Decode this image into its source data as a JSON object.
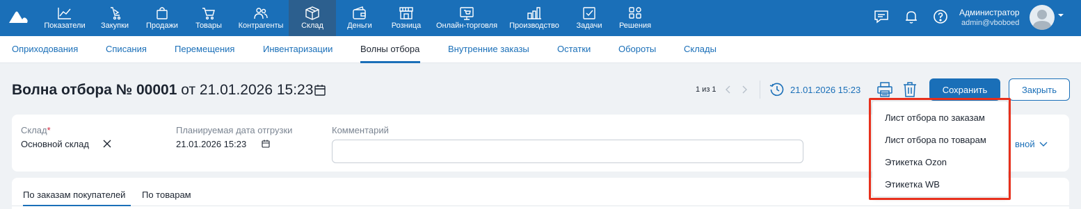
{
  "topnav": {
    "items": [
      {
        "label": "Показатели",
        "icon": "chart-line-icon"
      },
      {
        "label": "Закупки",
        "icon": "purchase-icon"
      },
      {
        "label": "Продажи",
        "icon": "shopping-bag-icon"
      },
      {
        "label": "Товары",
        "icon": "cart-icon"
      },
      {
        "label": "Контрагенты",
        "icon": "users-icon"
      },
      {
        "label": "Склад",
        "icon": "box-icon",
        "active": true
      },
      {
        "label": "Деньги",
        "icon": "wallet-icon"
      },
      {
        "label": "Розница",
        "icon": "store-icon"
      },
      {
        "label": "Онлайн-торговля",
        "icon": "online-store-icon"
      },
      {
        "label": "Производство",
        "icon": "factory-icon"
      },
      {
        "label": "Задачи",
        "icon": "task-check-icon"
      },
      {
        "label": "Решения",
        "icon": "apps-grid-icon"
      }
    ],
    "user": {
      "name": "Администратор",
      "email": "admin@vboboed"
    },
    "accent": "#1a6fb8",
    "active_bg": "#2c5f8e"
  },
  "subnav": {
    "items": [
      {
        "label": "Оприходования"
      },
      {
        "label": "Списания"
      },
      {
        "label": "Перемещения"
      },
      {
        "label": "Инвентаризации"
      },
      {
        "label": "Волны отбора",
        "active": true
      },
      {
        "label": "Внутренние заказы"
      },
      {
        "label": "Остатки"
      },
      {
        "label": "Обороты"
      },
      {
        "label": "Склады"
      }
    ]
  },
  "document": {
    "title": "Волна отбора № 00001",
    "date_prefix": "от",
    "date": "21.01.2026 15:23",
    "pager": "1 из 1",
    "history_date": "21.01.2026 15:23",
    "save_label": "Сохранить",
    "close_label": "Закрыть"
  },
  "form": {
    "warehouse_label": "Склад",
    "required_mark": "*",
    "warehouse_value": "Основной склад",
    "ship_label": "Планируемая дата отгрузки",
    "ship_value": "21.01.2026 15:23",
    "comment_label": "Комментарий",
    "comment_value": "",
    "partial_value": "вной"
  },
  "tabs": [
    {
      "label": "По заказам покупателей",
      "active": true
    },
    {
      "label": "По товарам"
    }
  ],
  "print_menu": {
    "items": [
      "Лист отбора по заказам",
      "Лист отбора по товарам",
      "Этикетка Ozon",
      "Этикетка WB"
    ],
    "highlight_color": "#e8301c"
  }
}
